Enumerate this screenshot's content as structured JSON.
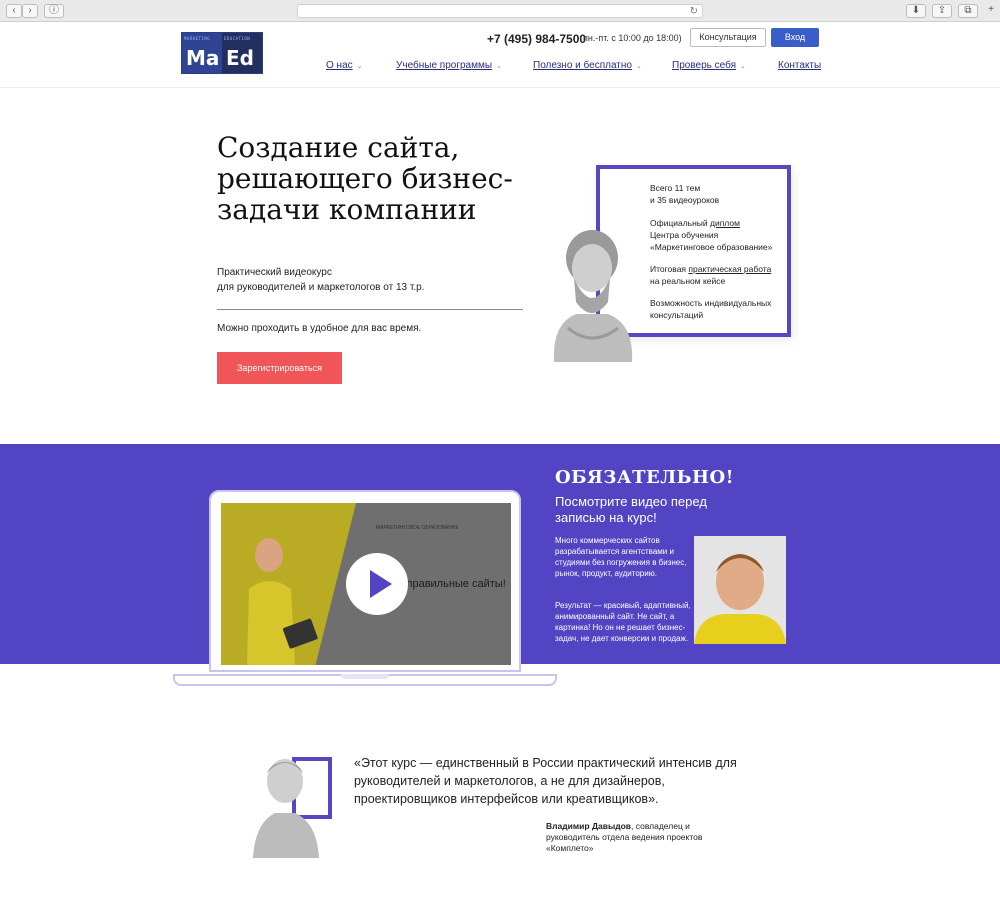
{
  "header": {
    "logo_small_left": "MARKETING",
    "logo_small_right": "EDUCATION",
    "logo_big_left": "Ma",
    "logo_big_right": "Ed",
    "phone": "+7 (495) 984-7500",
    "hours": "(пн.-пт. с 10:00 до 18:00)",
    "consult_label": "Консультация",
    "login_label": "Вход",
    "nav": [
      "О нас",
      "Учебные программы",
      "Полезно и бесплатно",
      "Проверь себя",
      "Контакты"
    ]
  },
  "hero": {
    "title": "Создание сайта, решающего бизнес-задачи компании",
    "subtitle_line1": "Практический видеокурс",
    "subtitle_line2": "для руководителей и маркетологов от 13 т.р.",
    "note": "Можно проходить в удобное для вас время.",
    "register_label": "Зарегистрироваться"
  },
  "features": {
    "f1_line1": "Всего 11 тем",
    "f1_line2": "и 35 видеоуроков",
    "f2_pre": "Официальный ",
    "f2_link": "диплом",
    "f2_line2": "Центра обучения",
    "f2_line3": "«Маркетинговое образование»",
    "f3_pre": "Итоговая ",
    "f3_link": "практическая работа",
    "f3_line2": "на реальном кейсе",
    "f4_line1": "Возможность индивидуальных",
    "f4_line2": "консультаций"
  },
  "video": {
    "screen_text": "і правильные сайты!",
    "screen_logo": "МАРКЕТИНГОВОЕ ОБРАЗОВАНИЕ",
    "must": "ОБЯЗАТЕЛЬНО!",
    "watch": "Посмотрите видео перед записью на курс!",
    "p1": "Много коммерческих сайтов разрабатывается агентствами и студиями без погружения в бизнес, рынок, продукт, аудиторию.",
    "p2": "Результат — красивый, адаптивный, анимированный сайт. Не сайт, а картинка! Но он не решает бизнес-задач, не дает конверсии и продаж."
  },
  "quote": {
    "text": "«Этот курс — единственный в России практический интенсив для руководителей и маркетологов, а не для дизайнеров, проектировщиков интерфейсов или креативщиков».",
    "author_name": "Владимир Давыдов",
    "author_role": ", совладелец и руководитель отдела ведения проектов «Комплето»"
  },
  "colors": {
    "accent_purple": "#5344c3",
    "frame_purple": "#5a45c2",
    "register_red": "#f05658",
    "login_blue": "#3a5ec9",
    "nav_blue": "#2a2d7c"
  }
}
